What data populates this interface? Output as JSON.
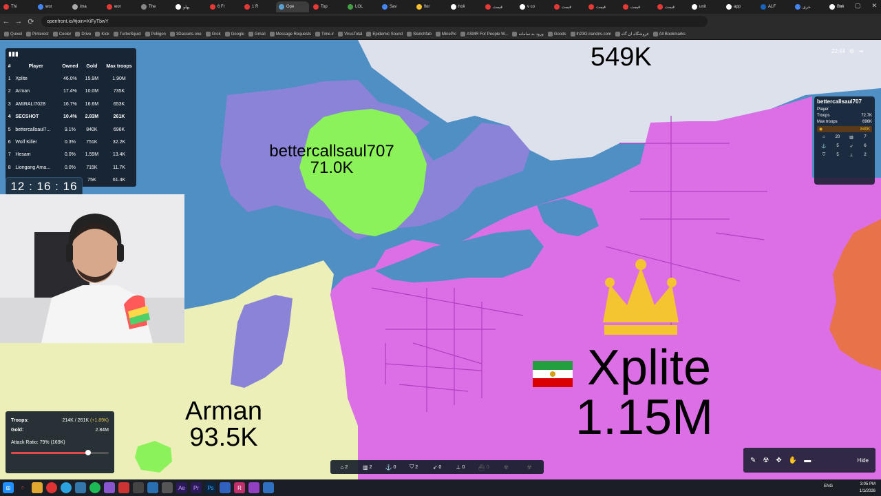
{
  "browser": {
    "tabs": [
      {
        "label": "Thi",
        "color": "#e53935",
        "active": false
      },
      {
        "label": "wor",
        "color": "#4285f4",
        "active": false
      },
      {
        "label": "ima",
        "color": "#aaaaaa",
        "active": false
      },
      {
        "label": "wor",
        "color": "#e53935",
        "active": false
      },
      {
        "label": "The",
        "color": "#888888",
        "active": false
      },
      {
        "label": "پهلو",
        "color": "#ffffff",
        "active": false
      },
      {
        "label": "6 Fr",
        "color": "#e53935",
        "active": false
      },
      {
        "label": "1 R",
        "color": "#e53935",
        "active": false
      },
      {
        "label": "Ope",
        "color": "#5aa0d0",
        "active": true
      },
      {
        "label": "Top",
        "color": "#e53935",
        "active": false
      },
      {
        "label": "LOL",
        "color": "#43a047",
        "active": false
      },
      {
        "label": "Sav",
        "color": "#4285f4",
        "active": false
      },
      {
        "label": "flor",
        "color": "#fbc02d",
        "active": false
      },
      {
        "label": "holi",
        "color": "#ffffff",
        "active": false
      },
      {
        "label": "قیمت",
        "color": "#e53935",
        "active": false
      },
      {
        "label": "v co",
        "color": "#ffffff",
        "active": false
      },
      {
        "label": "قیمت",
        "color": "#e53935",
        "active": false
      },
      {
        "label": "قیمت",
        "color": "#e53935",
        "active": false
      },
      {
        "label": "قیمت",
        "color": "#e53935",
        "active": false
      },
      {
        "label": "قیمت",
        "color": "#e53935",
        "active": false
      },
      {
        "label": "unit",
        "color": "#ffffff",
        "active": false
      },
      {
        "label": "app",
        "color": "#ffffff",
        "active": false
      },
      {
        "label": "ALF",
        "color": "#1565c0",
        "active": false
      },
      {
        "label": "خری",
        "color": "#4285f4",
        "active": false
      },
      {
        "label": "Bak",
        "color": "#ffffff",
        "active": false
      }
    ],
    "url": "openfront.io/#join=XiFyTbwY",
    "bookmarks": [
      "Quixel",
      "Pinterest",
      "Cooler",
      "Drive",
      "Kick",
      "TurboSquid",
      "Poliigon",
      "3Dassets.one",
      "Grok",
      "Google",
      "Gmail",
      "Message Requests",
      "Time.ir",
      "VirusTotal",
      "Epidemic Sound",
      "Sketchfab",
      "MinePic",
      "ASMR For People W...",
      "ورود به سامانه",
      "Goods",
      "lh23G.irandns.com",
      "فروشگاه ان گاه",
      "All Bookmarks"
    ]
  },
  "leaderboard": {
    "headers": {
      "rank": "#",
      "player": "Player",
      "owned": "Owned",
      "gold": "Gold",
      "troops": "Max troops"
    },
    "rows": [
      {
        "rank": "1",
        "player": "Xplite",
        "owned": "46.0%",
        "gold": "15.9M",
        "troops": "1.90M",
        "bold": false
      },
      {
        "rank": "2",
        "player": "Arman",
        "owned": "17.4%",
        "gold": "10.0M",
        "troops": "735K",
        "bold": false
      },
      {
        "rank": "3",
        "player": "AMIRALI7028",
        "owned": "16.7%",
        "gold": "16.6M",
        "troops": "653K",
        "bold": false
      },
      {
        "rank": "4",
        "player": "SECSHOT",
        "owned": "10.4%",
        "gold": "2.83M",
        "troops": "261K",
        "bold": true
      },
      {
        "rank": "5",
        "player": "bettercallsaul7...",
        "owned": "9.1%",
        "gold": "840K",
        "troops": "696K",
        "bold": false
      },
      {
        "rank": "6",
        "player": "Wolf Killer",
        "owned": "0.3%",
        "gold": "751K",
        "troops": "32.2K",
        "bold": false
      },
      {
        "rank": "7",
        "player": "Hesam",
        "owned": "0.0%",
        "gold": "1.59M",
        "troops": "13.4K",
        "bold": false
      },
      {
        "rank": "8",
        "player": "Liongang Ama...",
        "owned": "0.0%",
        "gold": "715K",
        "troops": "11.7K",
        "bold": false
      },
      {
        "rank": "9",
        "player": "",
        "owned": "",
        "gold": "75K",
        "troops": "61.4K",
        "bold": false
      }
    ]
  },
  "timer": "12 : 16 : 16",
  "topright": {
    "time": "22:44"
  },
  "player_panel": {
    "name": "bettercallsaul707",
    "type": "Player",
    "troops_label": "Troops",
    "troops": "72.7K",
    "max_label": "Max troops",
    "max": "696K",
    "gold": "840K",
    "buildings": [
      "20",
      "7",
      "5",
      "6",
      "5",
      "2"
    ]
  },
  "map_labels": {
    "top_count": "549K",
    "saul_name": "bettercallsaul707",
    "saul_troops": "71.0K",
    "arman_name": "Arman",
    "arman_troops": "93.5K",
    "xplite_name": "Xplite",
    "xplite_troops": "1.15M"
  },
  "stats": {
    "troops_label": "Troops:",
    "troops": "214K / 261K",
    "troops_delta": "(+1.89K)",
    "gold_label": "Gold:",
    "gold": "2.84M",
    "attack_label": "Attack Ratio: 79% (169K)",
    "attack_ratio": 0.79
  },
  "buildbar": [
    {
      "icon": "city-icon",
      "glyph": "⌂",
      "count": "2",
      "enabled": true
    },
    {
      "icon": "factory-icon",
      "glyph": "▥",
      "count": "2",
      "enabled": true
    },
    {
      "icon": "port-icon",
      "glyph": "⚓",
      "count": "0",
      "enabled": true
    },
    {
      "icon": "defense-post-icon",
      "glyph": "⛉",
      "count": "2",
      "enabled": true
    },
    {
      "icon": "missile-silo-icon",
      "glyph": "➶",
      "count": "0",
      "enabled": true
    },
    {
      "icon": "sam-launcher-icon",
      "glyph": "⊥",
      "count": "0",
      "enabled": true
    },
    {
      "icon": "warship-icon",
      "glyph": "⛴",
      "count": "0",
      "enabled": false
    },
    {
      "icon": "atom-bomb-icon",
      "glyph": "☢",
      "count": "",
      "enabled": false
    },
    {
      "icon": "hydrogen-bomb-icon",
      "glyph": "☢",
      "count": "",
      "enabled": false
    }
  ],
  "emoji_bar": {
    "hide": "Hide"
  },
  "taskbar": {
    "lang": "ENG",
    "time": "3:05 PM",
    "date": "1/1/2026"
  },
  "colors": {
    "ocean": "#4f8fc4",
    "xplite": "#dc6fe6",
    "arman": "#ecefb8",
    "saul_blob": "#8cf25a",
    "purple": "#8a83d8",
    "grey": "#dde1ec",
    "orange": "#e8734a"
  }
}
